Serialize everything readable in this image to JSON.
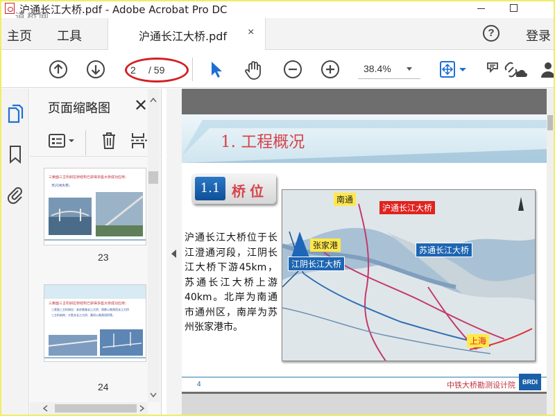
{
  "window": {
    "title": "沪通长江大桥.pdf - Adobe Acrobat Pro DC",
    "watermark": "道桥网"
  },
  "tabs": {
    "home": "主页",
    "tools": "工具",
    "document": "沪通长江大桥.pdf",
    "close_glyph": "×",
    "help_glyph": "?",
    "login": "登录"
  },
  "toolbar": {
    "current_page": "2",
    "total_pages": "/ 59",
    "zoom": "38.4%"
  },
  "thumbnails": {
    "title": "页面缩略图",
    "close_glyph": "✕",
    "pages": [
      {
        "number": "23",
        "heading": "三索面三主桁斜拉桥结构已获得多座大桥成功应用：",
        "bullet": "天兴洲大桥。"
      },
      {
        "number": "24",
        "heading": "三索面三主桁斜拉桥结构已获得多座大桥成功应用：",
        "bullet_1": "三索面三主桁斜拉：安庆铁路长江大桥、铜陵公铁两用长江大桥",
        "bullet_2": "三主桁结构：大胜关长江大桥、黄冈公铁两用桥等。"
      }
    ]
  },
  "page": {
    "banner_title": "1. 工程概况",
    "section_number": "1.1",
    "section_label": "桥位",
    "body": "沪通长江大桥位于长江澄通河段，江阴长江大桥下游45km，苏通长江大桥上游40km。北岸为南通市通州区，南岸为苏州张家港市。",
    "map_labels": {
      "nantong": "南通",
      "hutong": "沪通长江大桥",
      "zhangjiagang": "张家港",
      "sutong": "苏通长江大桥",
      "jiangyin": "江阴长江大桥",
      "shanghai": "上海"
    },
    "footer_page": "4",
    "footer_org": "中铁大桥勘测设计院",
    "footer_logo": "BRDI"
  },
  "colors": {
    "window_border": "#f0ee62",
    "accent_red": "#d41f24",
    "title_red": "#d7434b",
    "badge_blue": "#1a5fa8"
  }
}
